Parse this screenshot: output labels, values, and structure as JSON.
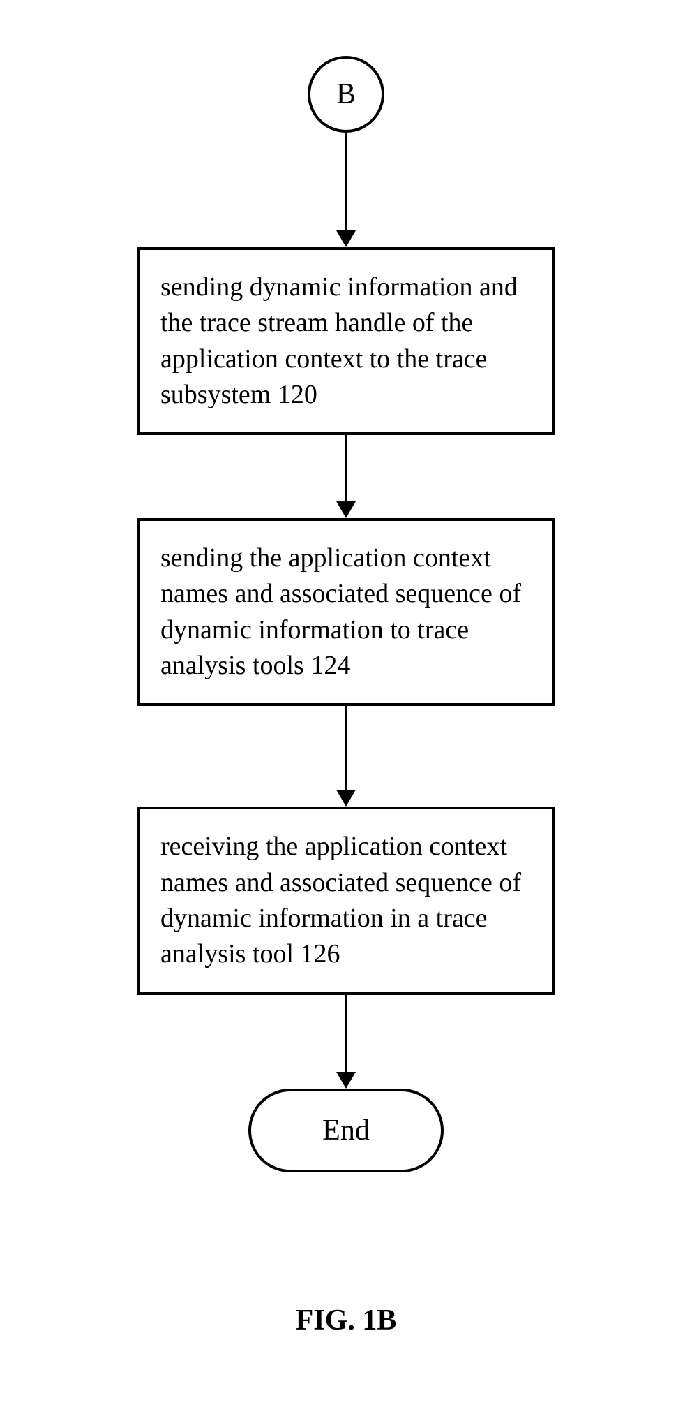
{
  "flowchart": {
    "connector": "B",
    "steps": [
      {
        "text": "sending dynamic information and the trace stream handle of the application context to the trace subsystem 120"
      },
      {
        "text": "sending the application context names and associated sequence of dynamic information to trace analysis tools 124"
      },
      {
        "text": "receiving the application context names and associated sequence of dynamic information in a trace analysis tool 126"
      }
    ],
    "terminator": "End",
    "figure_label": "FIG. 1B"
  }
}
